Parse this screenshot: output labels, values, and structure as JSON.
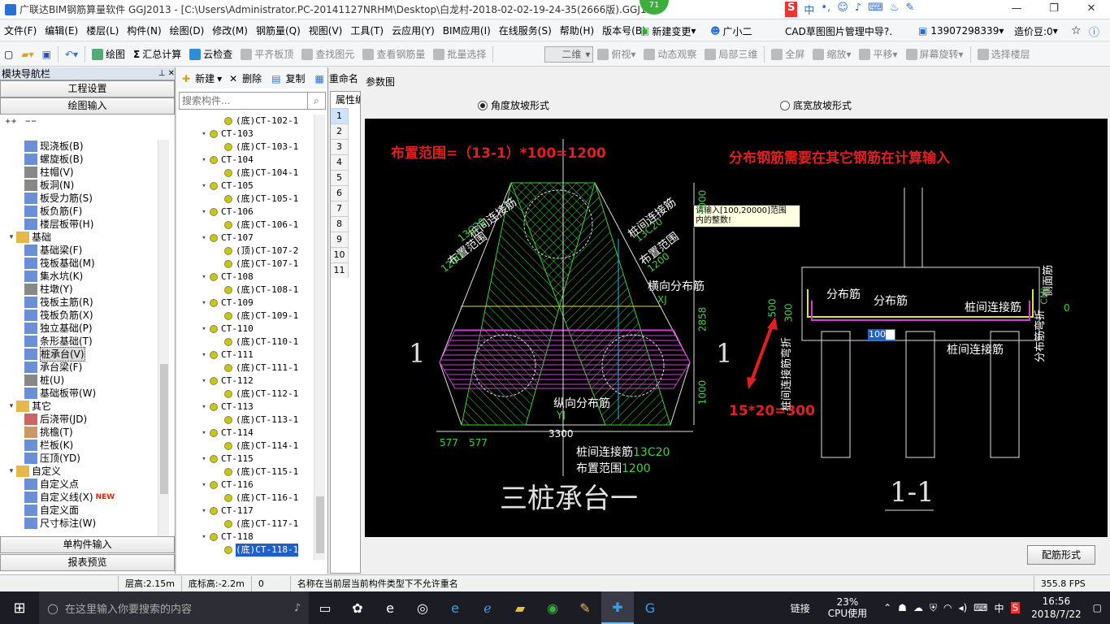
{
  "title": {
    "text": "广联达BIM钢筋算量软件 GGJ2013 - [C:\\Users\\Administrator.PC-20141127NRHM\\Desktop\\白龙村-2018-02-02-19-24-35(2666版).GGJ12",
    "badge": "71"
  },
  "menu": [
    "文件(F)",
    "编辑(E)",
    "楼层(L)",
    "构件(N)",
    "绘图(D)",
    "修改(M)",
    "钢筋量(Q)",
    "视图(V)",
    "工具(T)",
    "云应用(Y)",
    "BIM应用(I)",
    "在线服务(S)",
    "帮助(H)",
    "版本号(B)"
  ],
  "menu_right": {
    "change": "新建变更",
    "assistant": "广小二",
    "cad": "CAD草图图片管理中导?.",
    "phone": "13907298339",
    "price": "造价豆:0"
  },
  "toolbar": {
    "draw": "绘图",
    "summary": "汇总计算",
    "cloud": "云检查",
    "flush": "平齐板顶",
    "find": "查找图元",
    "view_rebar": "查看钢筋量",
    "batch": "批量选择",
    "view_mode": "二维",
    "top_view": "俯视",
    "dynamic": "动态观察",
    "local3d": "局部三维",
    "fullscreen": "全屏",
    "zoom": "缩放",
    "pan": "平移",
    "rotate": "屏幕旋转",
    "select_floor": "选择楼层"
  },
  "nav": {
    "title": "模块导航栏",
    "pin": "ᅟ 4 ✕",
    "btn_project": "工程设置",
    "btn_draw": "绘图输入",
    "btn_single": "单构件输入",
    "btn_report": "报表预览",
    "tree": [
      {
        "label": "现浇板(B)",
        "level": 2,
        "color": "#6b8fd6"
      },
      {
        "label": "螺旋板(B)",
        "level": 2,
        "color": "#6b8fd6"
      },
      {
        "label": "柱帽(V)",
        "level": 2,
        "color": "#888"
      },
      {
        "label": "板洞(N)",
        "level": 2,
        "color": "#888"
      },
      {
        "label": "板受力筋(S)",
        "level": 2,
        "color": "#6b8fd6"
      },
      {
        "label": "板负筋(F)",
        "level": 2,
        "color": "#6b8fd6"
      },
      {
        "label": "楼层板带(H)",
        "level": 2,
        "color": "#6b8fd6"
      },
      {
        "label": "基础",
        "level": 1,
        "color": "#e6b84a",
        "exp": "▾"
      },
      {
        "label": "基础梁(F)",
        "level": 2,
        "color": "#6b8fd6"
      },
      {
        "label": "筏板基础(M)",
        "level": 2,
        "color": "#6b8fd6"
      },
      {
        "label": "集水坑(K)",
        "level": 2,
        "color": "#6b8fd6"
      },
      {
        "label": "柱墩(Y)",
        "level": 2,
        "color": "#888"
      },
      {
        "label": "筏板主筋(R)",
        "level": 2,
        "color": "#6b8fd6"
      },
      {
        "label": "筏板负筋(X)",
        "level": 2,
        "color": "#6b8fd6"
      },
      {
        "label": "独立基础(P)",
        "level": 2,
        "color": "#6b8fd6"
      },
      {
        "label": "条形基础(T)",
        "level": 2,
        "color": "#6b8fd6"
      },
      {
        "label": "桩承台(V)",
        "level": 2,
        "color": "#6b8fd6",
        "sel": true
      },
      {
        "label": "承台梁(F)",
        "level": 2,
        "color": "#6b8fd6"
      },
      {
        "label": "桩(U)",
        "level": 2,
        "color": "#888"
      },
      {
        "label": "基础板带(W)",
        "level": 2,
        "color": "#6b8fd6"
      },
      {
        "label": "其它",
        "level": 1,
        "color": "#e6b84a",
        "exp": "▾"
      },
      {
        "label": "后浇带(JD)",
        "level": 2,
        "color": "#c66"
      },
      {
        "label": "挑檐(T)",
        "level": 2,
        "color": "#c96"
      },
      {
        "label": "栏板(K)",
        "level": 2,
        "color": "#6b8fd6"
      },
      {
        "label": "压顶(YD)",
        "level": 2,
        "color": "#6b8fd6"
      },
      {
        "label": "自定义",
        "level": 1,
        "color": "#e6b84a",
        "exp": "▾"
      },
      {
        "label": "自定义点",
        "level": 2,
        "color": "#6b8fd6"
      },
      {
        "label": "自定义线(X)",
        "level": 2,
        "color": "#6b8fd6",
        "new": "NEW"
      },
      {
        "label": "自定义面",
        "level": 2,
        "color": "#6b8fd6"
      },
      {
        "label": "尺寸标注(W)",
        "level": 2,
        "color": "#6b8fd6"
      }
    ]
  },
  "clist": {
    "new": "新建",
    "delete": "删除",
    "copy": "复制",
    "rename": "重命名",
    "search_placeholder": "搜索构件...",
    "items": [
      {
        "label": "(底)CT-102-1",
        "level": 2
      },
      {
        "label": "CT-103",
        "level": 1
      },
      {
        "label": "(底)CT-103-1",
        "level": 2
      },
      {
        "label": "CT-104",
        "level": 1
      },
      {
        "label": "(底)CT-104-1",
        "level": 2
      },
      {
        "label": "CT-105",
        "level": 1
      },
      {
        "label": "(底)CT-105-1",
        "level": 2
      },
      {
        "label": "CT-106",
        "level": 1
      },
      {
        "label": "(底)CT-106-1",
        "level": 2
      },
      {
        "label": "CT-107",
        "level": 1
      },
      {
        "label": "(顶)CT-107-2",
        "level": 2
      },
      {
        "label": "(底)CT-107-1",
        "level": 2
      },
      {
        "label": "CT-108",
        "level": 1
      },
      {
        "label": "(底)CT-108-1",
        "level": 2
      },
      {
        "label": "CT-109",
        "level": 1
      },
      {
        "label": "(底)CT-109-1",
        "level": 2
      },
      {
        "label": "CT-110",
        "level": 1
      },
      {
        "label": "(底)CT-110-1",
        "level": 2
      },
      {
        "label": "CT-111",
        "level": 1
      },
      {
        "label": "(底)CT-111-1",
        "level": 2
      },
      {
        "label": "CT-112",
        "level": 1
      },
      {
        "label": "(底)CT-112-1",
        "level": 2
      },
      {
        "label": "CT-113",
        "level": 1
      },
      {
        "label": "(底)CT-113-1",
        "level": 2
      },
      {
        "label": "CT-114",
        "level": 1
      },
      {
        "label": "(底)CT-114-1",
        "level": 2
      },
      {
        "label": "CT-115",
        "level": 1
      },
      {
        "label": "(底)CT-115-1",
        "level": 2
      },
      {
        "label": "CT-116",
        "level": 1
      },
      {
        "label": "(底)CT-116-1",
        "level": 2
      },
      {
        "label": "CT-117",
        "level": 1
      },
      {
        "label": "(底)CT-117-1",
        "level": 2
      },
      {
        "label": "CT-118",
        "level": 1
      },
      {
        "label": "(底)CT-118-1",
        "level": 2,
        "sel": true
      }
    ]
  },
  "prop": {
    "header": "属性编",
    "rows": [
      "1",
      "2",
      "3",
      "4",
      "5",
      "6",
      "7",
      "8",
      "9",
      "10",
      "11"
    ]
  },
  "param": {
    "title": "参数图",
    "radio_angle": "角度放坡形式",
    "radio_width": "底宽放坡形式",
    "btn_config": "配筋形式",
    "drawing": {
      "note1": "布置范围=（13-1）*100=1200",
      "note2": "分布钢筋需要在其它钢筋在计算输入",
      "note3": "15*20=300",
      "tooltip1": "请输入[100,20000]范围",
      "tooltip2": "内的整数!",
      "input_value": "100",
      "title_left": "三桩承台一",
      "title_right": "1-1",
      "sec": "1",
      "lbl_pile_conn": "桩间连接筋",
      "lbl_13c20": "13C20",
      "lbl_range": "布置范围",
      "lbl_1200": "1200",
      "lbl_trans": "横向分布筋",
      "lbl_xj": "XJ",
      "lbl_long": "纵向分布筋",
      "lbl_yj": "YJ",
      "lbl_dist": "分布筋",
      "lbl_dist_bend": "分布筋弯折",
      "lbl_conn_bend": "桩间连接筋弯折",
      "lbl_side": "侧面筋",
      "lbl_cmj": "CMJ",
      "dim_3300": "3300",
      "dim_577a": "577",
      "dim_577b": "577",
      "dim_2858": "2858",
      "dim_1000a": "1000",
      "dim_1000b": "1000",
      "dim_500": "500",
      "dim_300": "300",
      "dim_0": "0"
    }
  },
  "status": {
    "floor_h": "层高:2.15m",
    "bottom_h": "底标高:-2.2m",
    "val": "0",
    "msg": "名称在当前层当前构件类型下不允许重名",
    "fps": "355.8 FPS"
  },
  "taskbar": {
    "search_placeholder": "在这里输入你要搜索的内容",
    "link": "链接",
    "cpu_pct": "23%",
    "cpu_label": "CPU使用",
    "ime": "中",
    "time": "16:56",
    "date": "2018/7/22"
  }
}
